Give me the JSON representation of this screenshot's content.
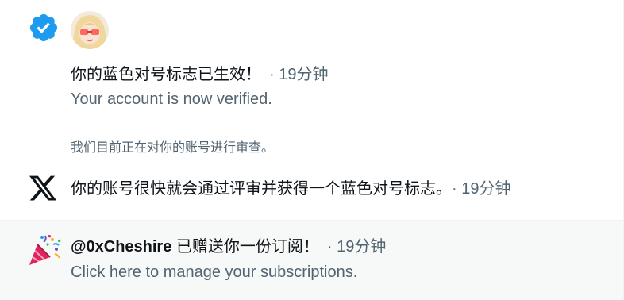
{
  "notifications": [
    {
      "icon": "verified-badge-icon",
      "title": "你的蓝色对号标志已生效！",
      "time": "· 19分钟",
      "subtitle": "Your account is now verified."
    },
    {
      "icon": "x-logo-icon",
      "note": "我们目前正在对你的账号进行审查。",
      "title": "你的账号很快就会通过评审并获得一个蓝色对号标志。",
      "time": "· 19分钟"
    },
    {
      "icon": "party-popper-icon",
      "handle": "@0xCheshire",
      "title": " 已赠送你一份订阅！",
      "time": "· 19分钟",
      "subtitle": "Click here to manage your subscriptions."
    }
  ],
  "colors": {
    "accent": "#1d9bf0",
    "secondary_text": "#536471",
    "highlight_bg": "#f7f9f9",
    "divider": "#eff3f4"
  }
}
